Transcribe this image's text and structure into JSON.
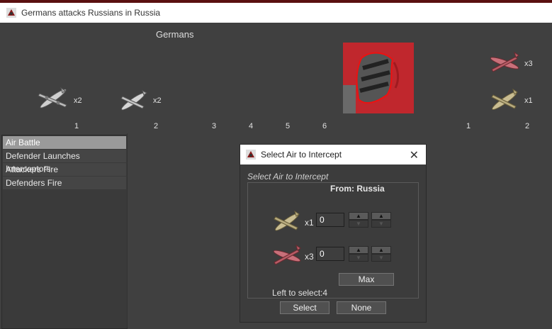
{
  "window": {
    "title": "Germans attacks Russians in Russia",
    "icon": "battle-app-icon"
  },
  "battle": {
    "side_label": "Germans",
    "attacker_units": [
      {
        "icon": "bomber-plane-icon",
        "count": "x2"
      },
      {
        "icon": "fighter-plane-icon",
        "count": "x2"
      }
    ],
    "defender_units": [
      {
        "icon": "red-fighter-plane-icon",
        "count": "x3"
      },
      {
        "icon": "tan-fighter-plane-icon",
        "count": "x1"
      }
    ],
    "attacker_columns": [
      "1",
      "2",
      "3",
      "4",
      "5",
      "6"
    ],
    "defender_columns": [
      "1",
      "2"
    ],
    "territory_icon": "territory-map-icon"
  },
  "steps": [
    "Air Battle",
    "Defender Launches Interceptors",
    "Attackers Fire",
    "Defenders Fire"
  ],
  "selected_step": 0,
  "dialog": {
    "title": "Select Air to Intercept",
    "close_icon": "close-icon",
    "subtitle": "Select Air to Intercept",
    "from": "From: Russia",
    "units": [
      {
        "icon": "tan-fighter-plane-icon",
        "multiplier": "x1",
        "value": "0"
      },
      {
        "icon": "red-fighter-plane-icon",
        "multiplier": "x3",
        "value": "0"
      }
    ],
    "max_label": "Max",
    "left_to_select": "Left to select:4",
    "select_label": "Select",
    "none_label": "None"
  },
  "colors": {
    "background": "#404040",
    "territory_red": "#c0272d",
    "panel": "#3c3c3c"
  }
}
